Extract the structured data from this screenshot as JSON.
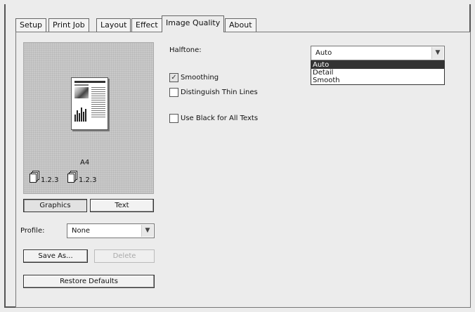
{
  "tabs": [
    "Setup",
    "Print Job",
    "Layout",
    "Effect",
    "Image Quality",
    "About"
  ],
  "active_tab": "Image Quality",
  "preview": {
    "paper_size": "A4",
    "page_numbers_1": "1.2.3",
    "page_numbers_2": "1.2.3"
  },
  "view_buttons": {
    "graphics": "Graphics",
    "text": "Text"
  },
  "profile": {
    "label": "Profile:",
    "value": "None"
  },
  "buttons": {
    "save_as": "Save As...",
    "delete": "Delete",
    "restore_defaults": "Restore Defaults"
  },
  "halftone": {
    "label": "Halftone:",
    "value": "Auto",
    "options": [
      "Auto",
      "Detail",
      "Smooth"
    ],
    "selected_index": 0
  },
  "options": {
    "smoothing": {
      "label": "Smoothing",
      "checked": true
    },
    "distinguish_thin_lines": {
      "label": "Distinguish Thin Lines",
      "checked": false
    },
    "use_black": {
      "label": "Use Black for All Texts",
      "checked": false
    }
  },
  "icons": {
    "checkmark": "check-icon",
    "dropdown_arrow": "chevron-down-icon"
  }
}
